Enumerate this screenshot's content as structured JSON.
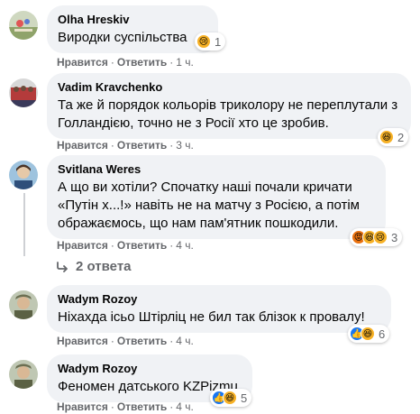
{
  "actions": {
    "like": "Нравится",
    "reply": "Ответить",
    "sep": "·"
  },
  "comments": [
    {
      "author": "Olha Hreskiv",
      "text": "Виродки суспільства",
      "time": "1 ч.",
      "reaction_count": "1"
    },
    {
      "author": "Vadim Kravchenko",
      "text": "Та же й порядок кольорів триколору не переплутали з Голландією, точно не з Росії хто це зробив.",
      "time": "3 ч.",
      "reaction_count": "2"
    },
    {
      "author": "Svitlana Weres",
      "text": "А що ви хотіли? Спочатку наші почали кричати «Путін х...!» навіть не на матчу з Росією, а потім ображаємось, що нам пам'ятник пошкодили.",
      "time": "4 ч.",
      "reaction_count": "3",
      "replies_label": "2 ответа"
    },
    {
      "author": "Wadym Rozoy",
      "text": "Ніхахда ісьо Штірліц не бил так блізок к провалу!",
      "time": "4 ч.",
      "reaction_count": "6"
    },
    {
      "author": "Wadym Rozoy",
      "text": "Феномен датського KZPizmu",
      "time": "4 ч.",
      "reaction_count": "5"
    }
  ],
  "colors": {
    "bubble": "#f0f2f5",
    "meta": "#65676b",
    "like": "#1877f2",
    "haha": "#f7b125",
    "angry": "#e9710f"
  },
  "icons": [
    "sad-reaction",
    "haha-reaction",
    "angry-reaction",
    "like-reaction",
    "reply-arrow"
  ]
}
